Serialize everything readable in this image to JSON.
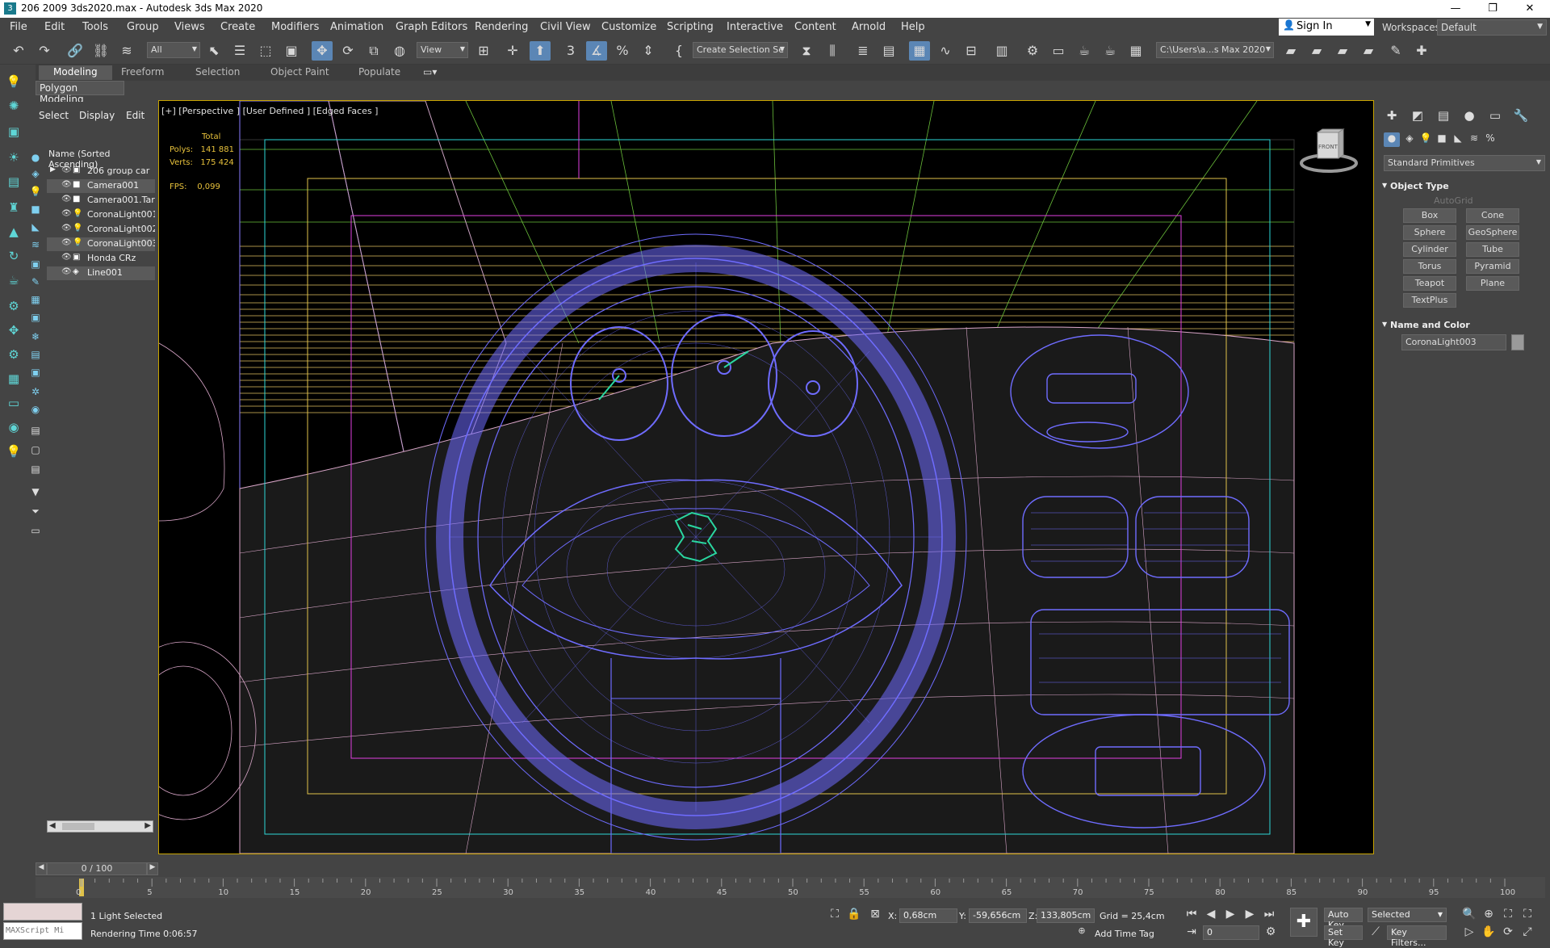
{
  "window": {
    "title": "206 2009 3ds2020.max - Autodesk 3ds Max 2020",
    "buttons": [
      "—",
      "❐",
      "✕"
    ]
  },
  "menu": [
    "File",
    "Edit",
    "Tools",
    "Group",
    "Views",
    "Create",
    "Modifiers",
    "Animation",
    "Graph Editors",
    "Rendering",
    "Civil View",
    "Customize",
    "Scripting",
    "Interactive",
    "Content",
    "Arnold",
    "Help"
  ],
  "account": {
    "sign_in": "Sign In",
    "workspaces_label": "Workspaces:",
    "workspace": "Default"
  },
  "toolbar": {
    "filter": "All",
    "ref_coord": "View",
    "selection_set": "Create Selection Se",
    "project_path": "C:\\Users\\a...s Max 2020"
  },
  "ribbon": {
    "tabs": [
      "Modeling",
      "Freeform",
      "Selection",
      "Object Paint",
      "Populate"
    ],
    "active": "Modeling",
    "panel": "Polygon Modeling"
  },
  "scene_explorer": {
    "tabs": [
      "Select",
      "Display",
      "Edit"
    ],
    "header": "Name (Sorted Ascending)",
    "items": [
      {
        "name": "206 group car",
        "selected": false
      },
      {
        "name": "Camera001",
        "selected": true
      },
      {
        "name": "Camera001.Targ",
        "selected": false
      },
      {
        "name": "CoronaLight001",
        "selected": false
      },
      {
        "name": "CoronaLight002",
        "selected": false
      },
      {
        "name": "CoronaLight003",
        "selected": true
      },
      {
        "name": "Honda CRz",
        "selected": false
      },
      {
        "name": "Line001",
        "selected": true
      }
    ]
  },
  "viewport": {
    "label": "[+] [Perspective ] [User Defined ] [Edged Faces ]",
    "stats_total": "Total",
    "polys_label": "Polys:",
    "polys_value": "141 881",
    "verts_label": "Verts:",
    "verts_value": "175 424",
    "fps_label": "FPS:",
    "fps_value": "0,099",
    "viewcube_face": "FRONT"
  },
  "command_panel": {
    "category": "Standard Primitives",
    "object_type_title": "Object Type",
    "autogrid": "AutoGrid",
    "primitives": [
      "Box",
      "Cone",
      "Sphere",
      "GeoSphere",
      "Cylinder",
      "Tube",
      "Torus",
      "Pyramid",
      "Teapot",
      "Plane",
      "TextPlus"
    ],
    "name_color_title": "Name and Color",
    "object_name": "CoronaLight003"
  },
  "timeline": {
    "frame": "0 / 100",
    "ticks": [
      "0",
      "5",
      "10",
      "15",
      "20",
      "25",
      "30",
      "35",
      "40",
      "45",
      "50",
      "55",
      "60",
      "65",
      "70",
      "75",
      "80",
      "85",
      "90",
      "95",
      "100"
    ]
  },
  "status": {
    "maxscript": "MAXScript Mi",
    "selection": "1 Light Selected",
    "render_time": "Rendering Time  0:06:57",
    "x_label": "X:",
    "x_value": "0,68cm",
    "y_label": "Y:",
    "y_value": "-59,656cm",
    "z_label": "Z:",
    "z_value": "133,805cm",
    "grid": "Grid = 25,4cm",
    "add_time_tag": "Add Time Tag",
    "auto_key": "Auto Key",
    "set_key": "Set Key",
    "key_mode": "Selected",
    "key_filters": "Key Filters...",
    "frame_field": "0"
  }
}
